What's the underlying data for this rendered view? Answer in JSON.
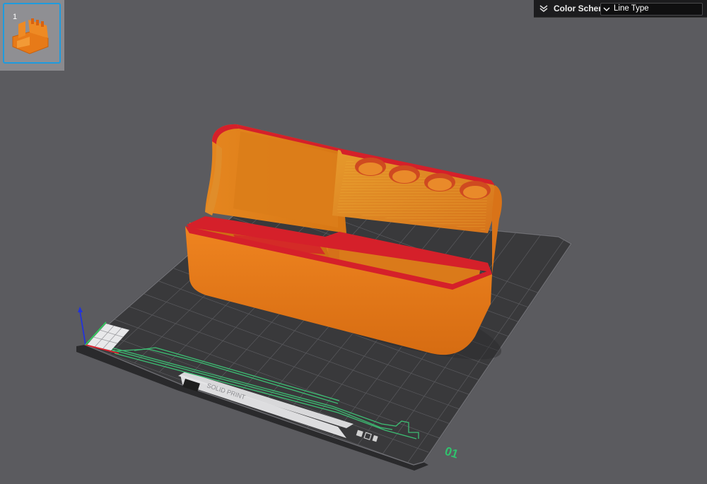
{
  "object_list": {
    "items": [
      {
        "number": "1",
        "selected": true
      }
    ]
  },
  "color_scheme": {
    "label": "Color Scheme",
    "selected": "Line Type"
  },
  "build_plate": {
    "plate_number": "01",
    "printed_text": "SOLID PRINT",
    "icon": "plate-icons"
  },
  "colors": {
    "model_body": "#e77a18",
    "model_outer_wall": "#d5202a",
    "model_infill": "#e9a823",
    "skirt_travel": "#3dbd73",
    "plate_surface": "#38383a",
    "accent": "#1f9bde"
  }
}
